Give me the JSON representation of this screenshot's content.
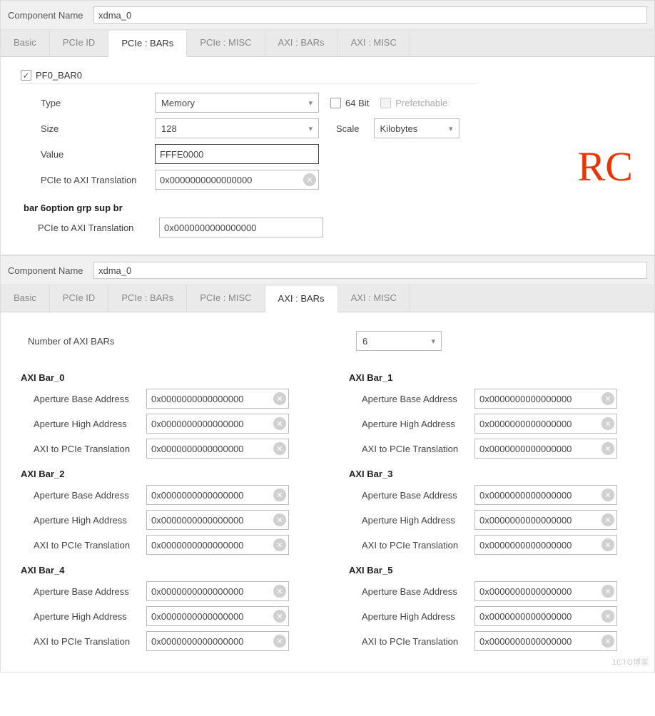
{
  "top": {
    "component_name_label": "Component Name",
    "component_name": "xdma_0",
    "tabs": [
      "Basic",
      "PCIe ID",
      "PCIe : BARs",
      "PCIe : MISC",
      "AXI : BARs",
      "AXI : MISC"
    ],
    "active_tab": 2,
    "pf0bar0": {
      "title": "PF0_BAR0",
      "checked": true,
      "type_label": "Type",
      "type_value": "Memory",
      "bit64_label": "64 Bit",
      "bit64_checked": false,
      "prefetch_label": "Prefetchable",
      "prefetch_enabled": false,
      "size_label": "Size",
      "size_value": "128",
      "scale_label": "Scale",
      "scale_value": "Kilobytes",
      "value_label": "Value",
      "value": "FFFE0000",
      "pcie_axi_label": "PCIe to AXI Translation",
      "pcie_axi_value": "0x0000000000000000"
    },
    "bar6": {
      "title": "bar 6option grp sup br",
      "pcie_axi_label": "PCIe to AXI Translation",
      "pcie_axi_value": "0x0000000000000000"
    },
    "watermark": "RC"
  },
  "bottom": {
    "component_name_label": "Component Name",
    "component_name": "xdma_0",
    "tabs": [
      "Basic",
      "PCIe ID",
      "PCIe : BARs",
      "PCIe : MISC",
      "AXI : BARs",
      "AXI : MISC"
    ],
    "active_tab": 4,
    "num_bars_label": "Number of AXI BARs",
    "num_bars_value": "6",
    "field_labels": {
      "base": "Aperture Base Address",
      "high": "Aperture High Address",
      "trans": "AXI to PCIe Translation"
    },
    "bars": [
      {
        "title": "AXI Bar_0",
        "base": "0x0000000000000000",
        "high": "0x0000000000000000",
        "trans": "0x0000000000000000"
      },
      {
        "title": "AXI Bar_1",
        "base": "0x0000000000000000",
        "high": "0x0000000000000000",
        "trans": "0x0000000000000000"
      },
      {
        "title": "AXI Bar_2",
        "base": "0x0000000000000000",
        "high": "0x0000000000000000",
        "trans": "0x0000000000000000"
      },
      {
        "title": "AXI Bar_3",
        "base": "0x0000000000000000",
        "high": "0x0000000000000000",
        "trans": "0x0000000000000000"
      },
      {
        "title": "AXI Bar_4",
        "base": "0x0000000000000000",
        "high": "0x0000000000000000",
        "trans": "0x0000000000000000"
      },
      {
        "title": "AXI Bar_5",
        "base": "0x0000000000000000",
        "high": "0x0000000000000000",
        "trans": "0x0000000000000000"
      }
    ],
    "footer_watermark": "1CTO博客"
  }
}
